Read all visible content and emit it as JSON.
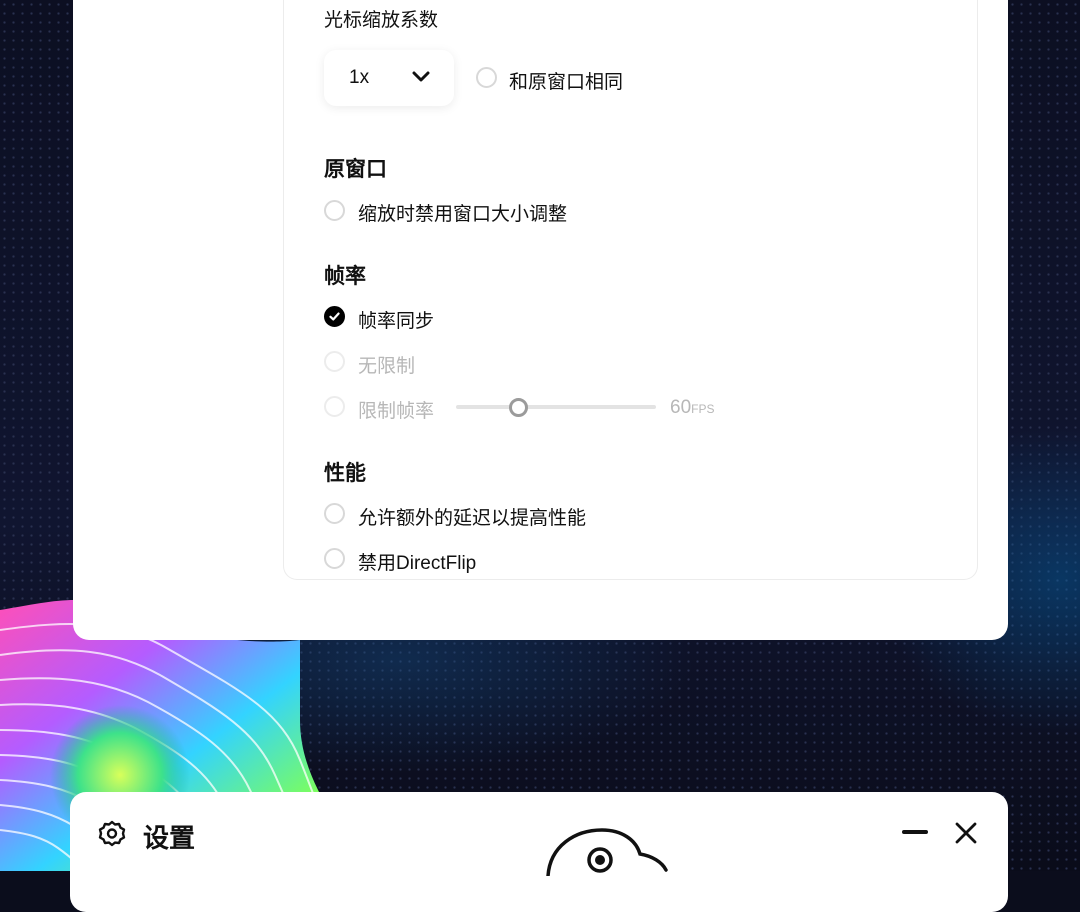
{
  "scaling": {
    "label": "光标缩放系数",
    "value": "1x",
    "same_as_original": "和原窗口相同"
  },
  "original_window": {
    "heading": "原窗口",
    "disable_resize": "缩放时禁用窗口大小调整"
  },
  "frame_rate": {
    "heading": "帧率",
    "options": [
      "帧率同步",
      "无限制",
      "限制帧率"
    ],
    "selected": "帧率同步",
    "limit_value": "60",
    "limit_unit": "FPS"
  },
  "performance": {
    "heading": "性能",
    "allow_latency": "允许额外的延迟以提高性能",
    "disable_directflip": "禁用DirectFlip"
  },
  "settings_window": {
    "title": "设置"
  }
}
